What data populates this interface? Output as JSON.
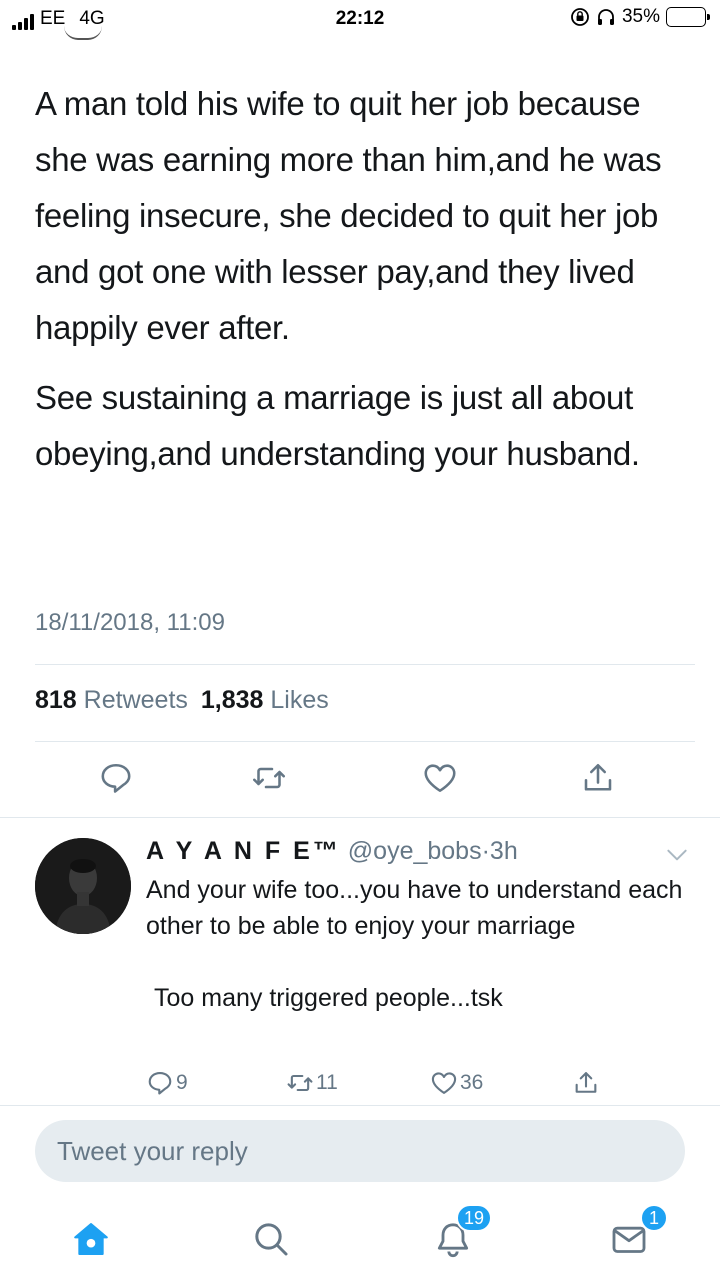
{
  "status_bar": {
    "carrier": "EE",
    "network": "4G",
    "time": "22:12",
    "battery": "35%",
    "battery_level": 0.35
  },
  "tweet": {
    "paragraphs": [
      "A man told his wife to quit her job because she was earning more than him,and he was feeling insecure, she decided to quit her job and got one with lesser pay,and they lived happily ever after.",
      "See sustaining a marriage is just all about obeying,and understanding your husband."
    ],
    "timestamp": "18/11/2018, 11:09",
    "retweets_count": "818",
    "retweets_label": "Retweets",
    "likes_count": "1,838",
    "likes_label": "Likes"
  },
  "tweet_actions": [
    "reply-icon",
    "retweet-icon",
    "like-icon",
    "share-icon"
  ],
  "reply": {
    "display_name": "A Y A N F E™",
    "handle": "@oye_bobs",
    "separator": "·",
    "time_ago": "3h",
    "text_lines": [
      "And your wife too...you have to understand each other to be able to enjoy your marriage",
      "Too many triggered people...tsk"
    ],
    "reply_count": "9",
    "retweet_count": "11",
    "like_count": "36"
  },
  "reply_box": {
    "placeholder": "Tweet your reply"
  },
  "tab_bar": {
    "items": [
      "home-icon",
      "search-icon",
      "notifications-icon",
      "messages-icon"
    ],
    "notifications_badge": "19",
    "messages_badge": "1"
  },
  "colors": {
    "accent": "#1da1f2",
    "secondary_text": "#657786",
    "primary_text": "#14171a",
    "battery_fill": "#f5c400"
  }
}
